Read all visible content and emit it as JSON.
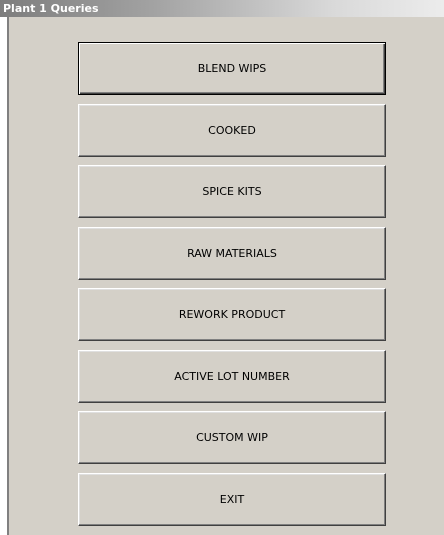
{
  "window": {
    "title": "Plant 1 Queries"
  },
  "buttons": [
    {
      "label": "BLEND WIPS"
    },
    {
      "label": "COOKED"
    },
    {
      "label": "SPICE KITS"
    },
    {
      "label": "RAW MATERIALS"
    },
    {
      "label": "REWORK PRODUCT"
    },
    {
      "label": "ACTIVE LOT NUMBER"
    },
    {
      "label": "CUSTOM WIP"
    },
    {
      "label": "EXIT"
    }
  ],
  "colors": {
    "form_background": "#d4d0c8",
    "title_text": "#ffffff"
  }
}
